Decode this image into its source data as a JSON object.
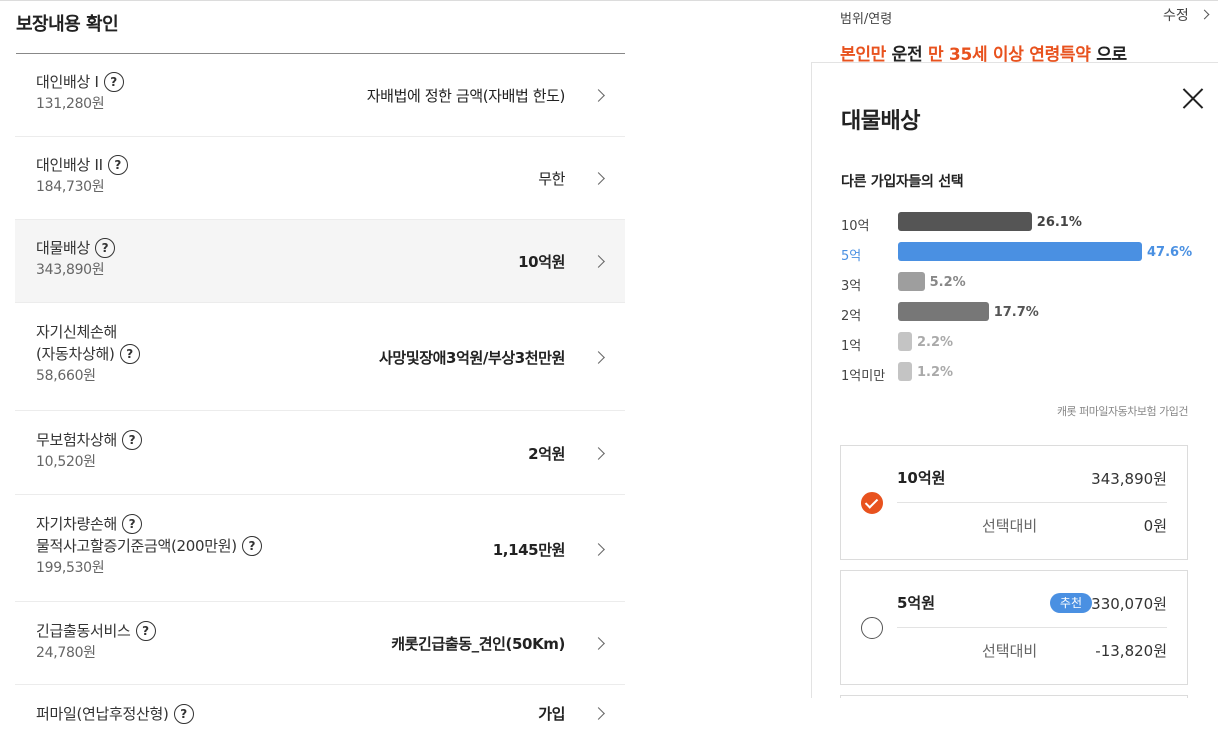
{
  "left": {
    "title": "보장내용 확인",
    "rows": [
      {
        "name": "대인배상 I",
        "price": "131,280원",
        "value": "자배법에 정한 금액(자배법 한도)",
        "bold": false
      },
      {
        "name": "대인배상 II",
        "price": "184,730원",
        "value": "무한",
        "bold": false
      },
      {
        "name": "대물배상",
        "price": "343,890원",
        "value": "10억원",
        "bold": true
      },
      {
        "name_line1": "자기신체손해",
        "name": "(자동차상해)",
        "price": "58,660원",
        "value": "사망및장애3억원/부상3천만원",
        "bold": true
      },
      {
        "name": "무보험차상해",
        "price": "10,520원",
        "value": "2억원",
        "bold": true
      },
      {
        "name_line1": "자기차량손해",
        "name": "물적사고할증기준금액(200만원)",
        "price": "199,530원",
        "value": "1,145만원",
        "bold": true
      },
      {
        "name": "긴급출동서비스",
        "price": "24,780원",
        "value": "캐롯긴급출동_견인(50Km)",
        "bold": true
      },
      {
        "name": "퍼마일(연납후정산형)",
        "price": "",
        "value": "가입",
        "bold": true
      }
    ],
    "help_glyph": "?"
  },
  "info": {
    "label": "범위/연령",
    "edit": "수정",
    "summary": {
      "p1": "본인만",
      "p2": " 운전 ",
      "p3": "만 35세 이상 연령특약",
      "p4": " 으로"
    }
  },
  "modal": {
    "title": "대물배상",
    "subtitle": "다른 가입자들의 선택",
    "source": "캐롯 퍼마일자동차보험 가입건",
    "colors": {
      "accent": "#e8521e",
      "blue": "#4a90e2"
    }
  },
  "chart_data": {
    "type": "bar",
    "title": "다른 가입자들의 선택",
    "categories": [
      "10억",
      "5억",
      "3억",
      "2억",
      "1억",
      "1억미만"
    ],
    "values": [
      26.1,
      47.6,
      5.2,
      17.7,
      2.2,
      1.2
    ],
    "value_labels": [
      "26.1%",
      "47.6%",
      "5.2%",
      "17.7%",
      "2.2%",
      "1.2%"
    ],
    "bar_colors": [
      "#555555",
      "#4a90e2",
      "#9e9e9e",
      "#777777",
      "#c4c4c4",
      "#c4c4c4"
    ],
    "label_colors": [
      "#444444",
      "#4a90e2",
      "#888888",
      "#555555",
      "#aaaaaa",
      "#aaaaaa"
    ],
    "highlight": "5억"
  },
  "options": [
    {
      "amount": "10억원",
      "price": "343,890원",
      "diff_label": "선택대비",
      "diff_value": "0원",
      "checked": true,
      "badge": ""
    },
    {
      "amount": "5억원",
      "price": "330,070원",
      "diff_label": "선택대비",
      "diff_value": "-13,820원",
      "checked": false,
      "badge": "추천"
    }
  ]
}
